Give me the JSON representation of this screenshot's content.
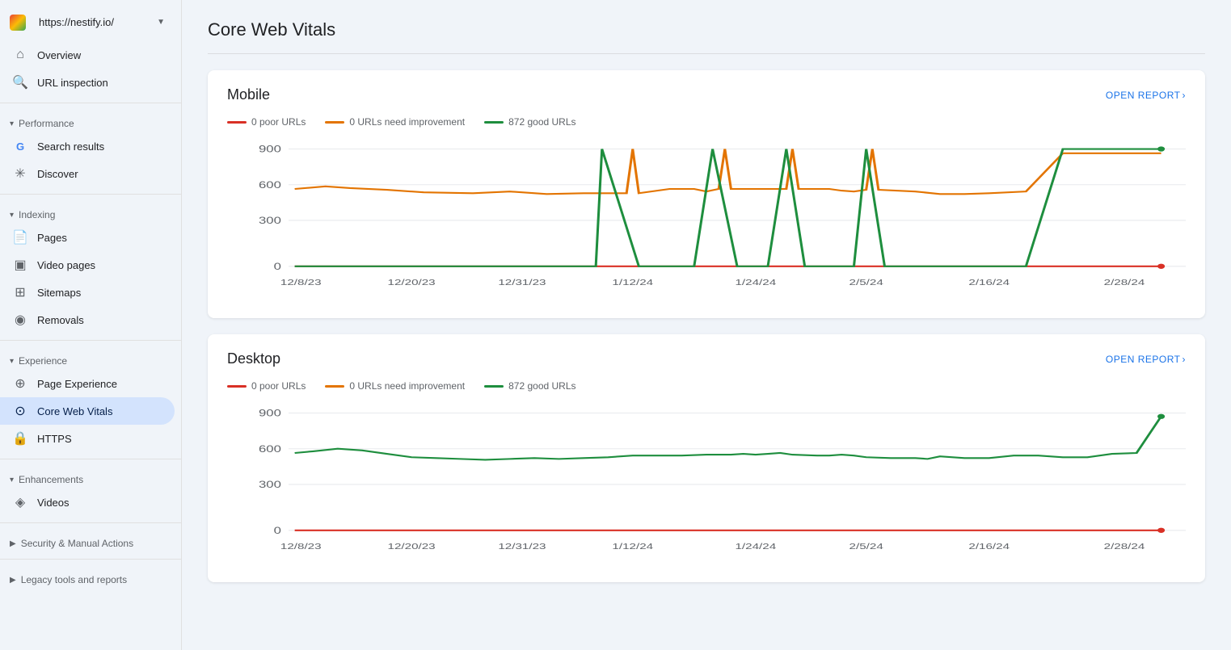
{
  "sidebar": {
    "site_url": "https://nestify.io/",
    "nav_items": [
      {
        "id": "overview",
        "label": "Overview",
        "icon": "home"
      },
      {
        "id": "url-inspection",
        "label": "URL inspection",
        "icon": "search"
      }
    ],
    "sections": [
      {
        "id": "performance",
        "label": "Performance",
        "expanded": true,
        "items": [
          {
            "id": "search-results",
            "label": "Search results",
            "icon": "google"
          },
          {
            "id": "discover",
            "label": "Discover",
            "icon": "asterisk"
          }
        ]
      },
      {
        "id": "indexing",
        "label": "Indexing",
        "expanded": true,
        "items": [
          {
            "id": "pages",
            "label": "Pages",
            "icon": "doc"
          },
          {
            "id": "video-pages",
            "label": "Video pages",
            "icon": "video"
          },
          {
            "id": "sitemaps",
            "label": "Sitemaps",
            "icon": "sitemap"
          },
          {
            "id": "removals",
            "label": "Removals",
            "icon": "removals"
          }
        ]
      },
      {
        "id": "experience",
        "label": "Experience",
        "expanded": true,
        "items": [
          {
            "id": "page-experience",
            "label": "Page Experience",
            "icon": "star"
          },
          {
            "id": "core-web-vitals",
            "label": "Core Web Vitals",
            "icon": "cwv",
            "active": true
          },
          {
            "id": "https",
            "label": "HTTPS",
            "icon": "lock"
          }
        ]
      },
      {
        "id": "enhancements",
        "label": "Enhancements",
        "expanded": true,
        "items": [
          {
            "id": "videos",
            "label": "Videos",
            "icon": "diamond"
          }
        ]
      },
      {
        "id": "security",
        "label": "Security & Manual Actions",
        "expanded": false,
        "items": []
      },
      {
        "id": "legacy",
        "label": "Legacy tools and reports",
        "expanded": false,
        "items": []
      }
    ]
  },
  "page": {
    "title": "Core Web Vitals"
  },
  "charts": {
    "mobile": {
      "title": "Mobile",
      "open_report_label": "OPEN REPORT",
      "legend": [
        {
          "id": "poor",
          "label": "0 poor URLs",
          "color": "#d93025"
        },
        {
          "id": "needs_improvement",
          "label": "0 URLs need improvement",
          "color": "#e37400"
        },
        {
          "id": "good",
          "label": "872 good URLs",
          "color": "#1e8e3e"
        }
      ],
      "y_labels": [
        "900",
        "600",
        "300",
        "0"
      ],
      "x_labels": [
        "12/8/23",
        "12/20/23",
        "12/31/23",
        "1/12/24",
        "1/24/24",
        "2/5/24",
        "2/16/24",
        "2/28/24"
      ]
    },
    "desktop": {
      "title": "Desktop",
      "open_report_label": "OPEN REPORT",
      "legend": [
        {
          "id": "poor",
          "label": "0 poor URLs",
          "color": "#d93025"
        },
        {
          "id": "needs_improvement",
          "label": "0 URLs need improvement",
          "color": "#e37400"
        },
        {
          "id": "good",
          "label": "872 good URLs",
          "color": "#1e8e3e"
        }
      ],
      "y_labels": [
        "900",
        "600",
        "300",
        "0"
      ],
      "x_labels": [
        "12/8/23",
        "12/20/23",
        "12/31/23",
        "1/12/24",
        "1/24/24",
        "2/5/24",
        "2/16/24",
        "2/28/24"
      ]
    }
  }
}
